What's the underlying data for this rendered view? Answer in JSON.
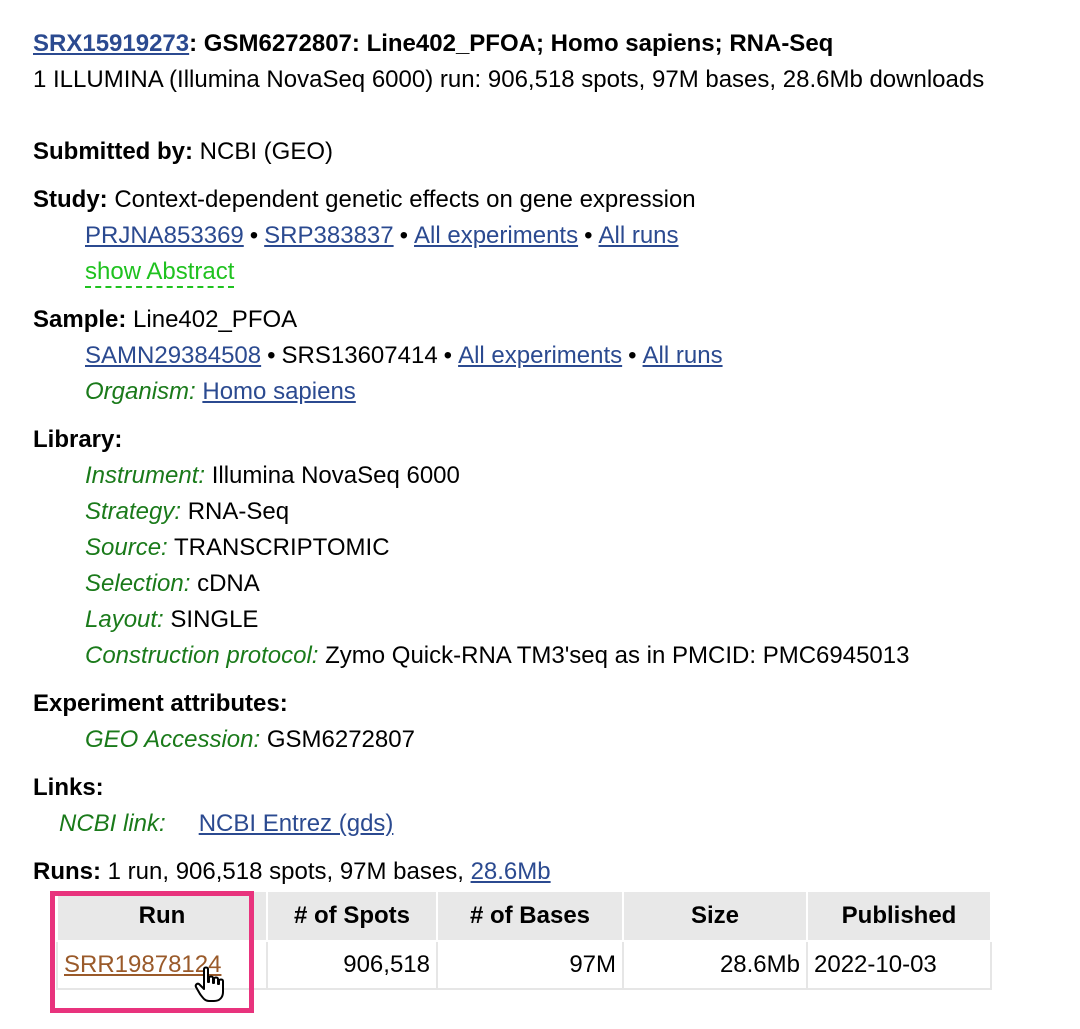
{
  "header": {
    "accession_link": "SRX15919273",
    "title_rest": ": GSM6272807: Line402_PFOA; Homo sapiens; RNA-Seq",
    "summary": "1 ILLUMINA (Illumina NovaSeq 6000) run: 906,518 spots, 97M bases, 28.6Mb downloads"
  },
  "submitted": {
    "label": "Submitted by:",
    "value": " NCBI (GEO)"
  },
  "study": {
    "label": "Study:",
    "value": " Context-dependent genetic effects on gene expression",
    "links": [
      "PRJNA853369",
      "SRP383837",
      "All experiments",
      "All runs"
    ],
    "bullet": "•",
    "abstract": "show Abstract"
  },
  "sample": {
    "label": "Sample:",
    "value": " Line402_PFOA",
    "link1": "SAMN29384508",
    "plain": "SRS13607414",
    "link2": "All experiments",
    "link3": "All runs",
    "bullet": "•",
    "organism_label": "Organism:",
    "organism_value": "Homo sapiens"
  },
  "library": {
    "label": "Library:",
    "fields": [
      {
        "k": "Instrument:",
        "v": " Illumina NovaSeq 6000"
      },
      {
        "k": "Strategy:",
        "v": " RNA-Seq"
      },
      {
        "k": "Source:",
        "v": " TRANSCRIPTOMIC"
      },
      {
        "k": "Selection:",
        "v": " cDNA"
      },
      {
        "k": "Layout:",
        "v": " SINGLE"
      },
      {
        "k": "Construction protocol:",
        "v": " Zymo Quick-RNA TM3'seq as in PMCID: PMC6945013"
      }
    ]
  },
  "attributes": {
    "label": "Experiment attributes:",
    "k": "GEO Accession:",
    "v": " GSM6272807"
  },
  "links": {
    "label": "Links:",
    "k": "NCBI link:",
    "v": "NCBI Entrez (gds)"
  },
  "runs": {
    "label": "Runs:",
    "summary": " 1 run, 906,518 spots, 97M bases, ",
    "size_link": "28.6Mb",
    "columns": [
      "Run",
      "# of Spots",
      "# of Bases",
      "Size",
      "Published"
    ],
    "row": {
      "run": "SRR19878124",
      "spots": "906,518",
      "bases": "97M",
      "size": "28.6Mb",
      "published": "2022-10-03"
    }
  },
  "colors": {
    "highlight": "#e8337d",
    "link": "#2b4a90",
    "italic_label": "#1a7a1a",
    "abstract": "#1fc21f"
  },
  "cursor_icon": "hand-pointer-icon"
}
